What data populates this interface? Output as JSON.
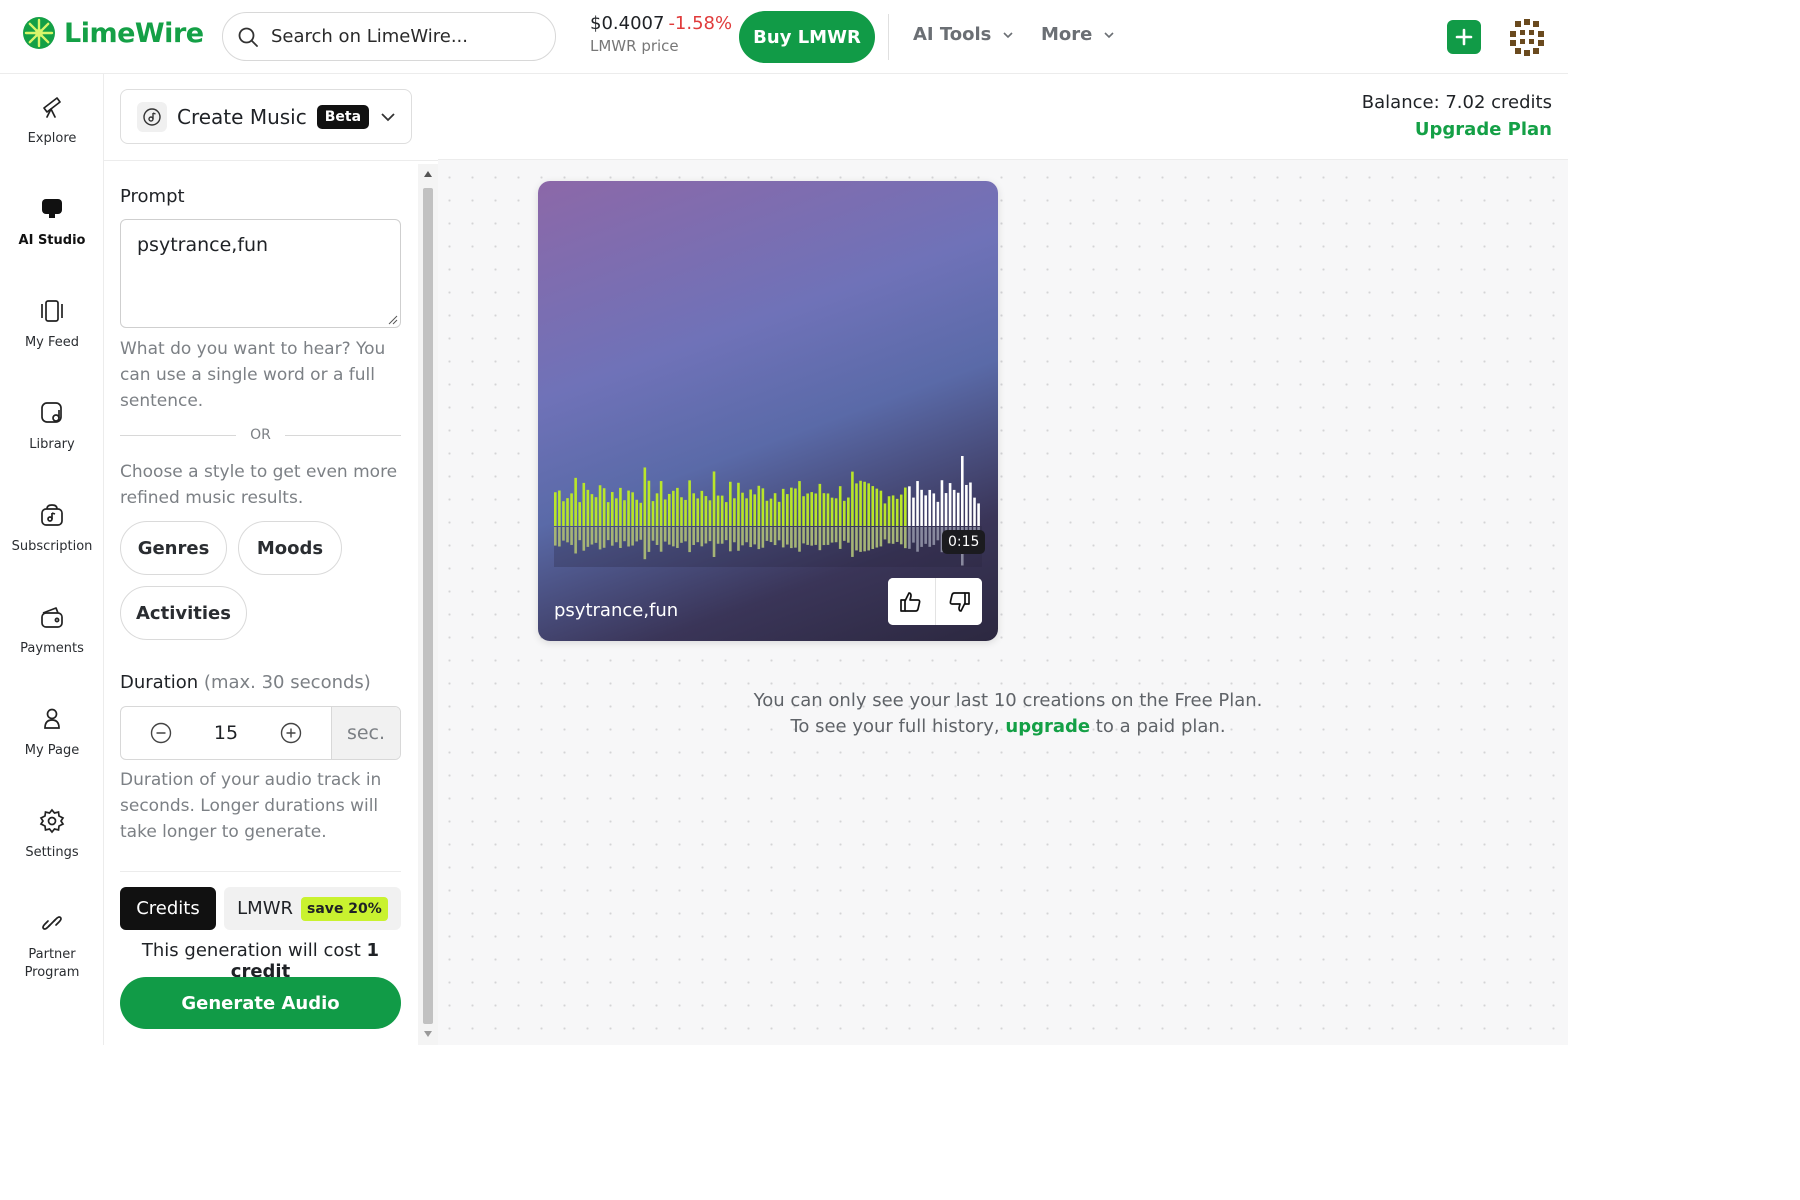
{
  "header": {
    "brand": "LimeWire",
    "search_placeholder": "Search on LimeWire...",
    "price_value": "$0.4007",
    "price_change": "-1.58%",
    "price_label": "LMWR price",
    "buy_label": "Buy LMWR",
    "menu_ai_tools": "AI Tools",
    "menu_more": "More"
  },
  "rail": {
    "items": [
      {
        "label": "Explore"
      },
      {
        "label": "AI Studio"
      },
      {
        "label": "My Feed"
      },
      {
        "label": "Library"
      },
      {
        "label": "Subscription"
      },
      {
        "label": "Payments"
      },
      {
        "label": "My Page"
      },
      {
        "label": "Settings"
      },
      {
        "label": "Partner Program"
      }
    ]
  },
  "panel": {
    "tool_label": "Create Music",
    "tool_badge": "Beta",
    "prompt_label": "Prompt",
    "prompt_value": "psytrance,fun",
    "prompt_help": "What do you want to hear? You can use a single word or a full sentence.",
    "or_text": "OR",
    "style_help": "Choose a style to get even more refined music results.",
    "chips": {
      "genres": "Genres",
      "moods": "Moods",
      "activities": "Activities"
    },
    "duration_label": "Duration",
    "duration_sub": "(max. 30 seconds)",
    "duration_value": "15",
    "duration_unit": "sec.",
    "duration_help": "Duration of your audio track in seconds. Longer durations will take longer to generate.",
    "pay_credits": "Credits",
    "pay_lmwr": "LMWR",
    "save_badge": "save 20%",
    "cost_prefix": "This generation will cost ",
    "cost_value": "1 credit",
    "generate_label": "Generate Audio"
  },
  "main": {
    "balance": "Balance: 7.02 credits",
    "upgrade_plan": "Upgrade Plan",
    "track": {
      "title": "psytrance,fun",
      "time": "0:15",
      "progress": 0.82
    },
    "note_line1": "You can only see your last 10 creations on the Free Plan.",
    "note_prefix": "To see your full history, ",
    "note_link": "upgrade",
    "note_suffix": " to a paid plan."
  },
  "colors": {
    "brand_green": "#119b47",
    "negative_red": "#e03b3b",
    "wave_played": "#b9e62a",
    "wave_unplayed": "#ffffff"
  }
}
